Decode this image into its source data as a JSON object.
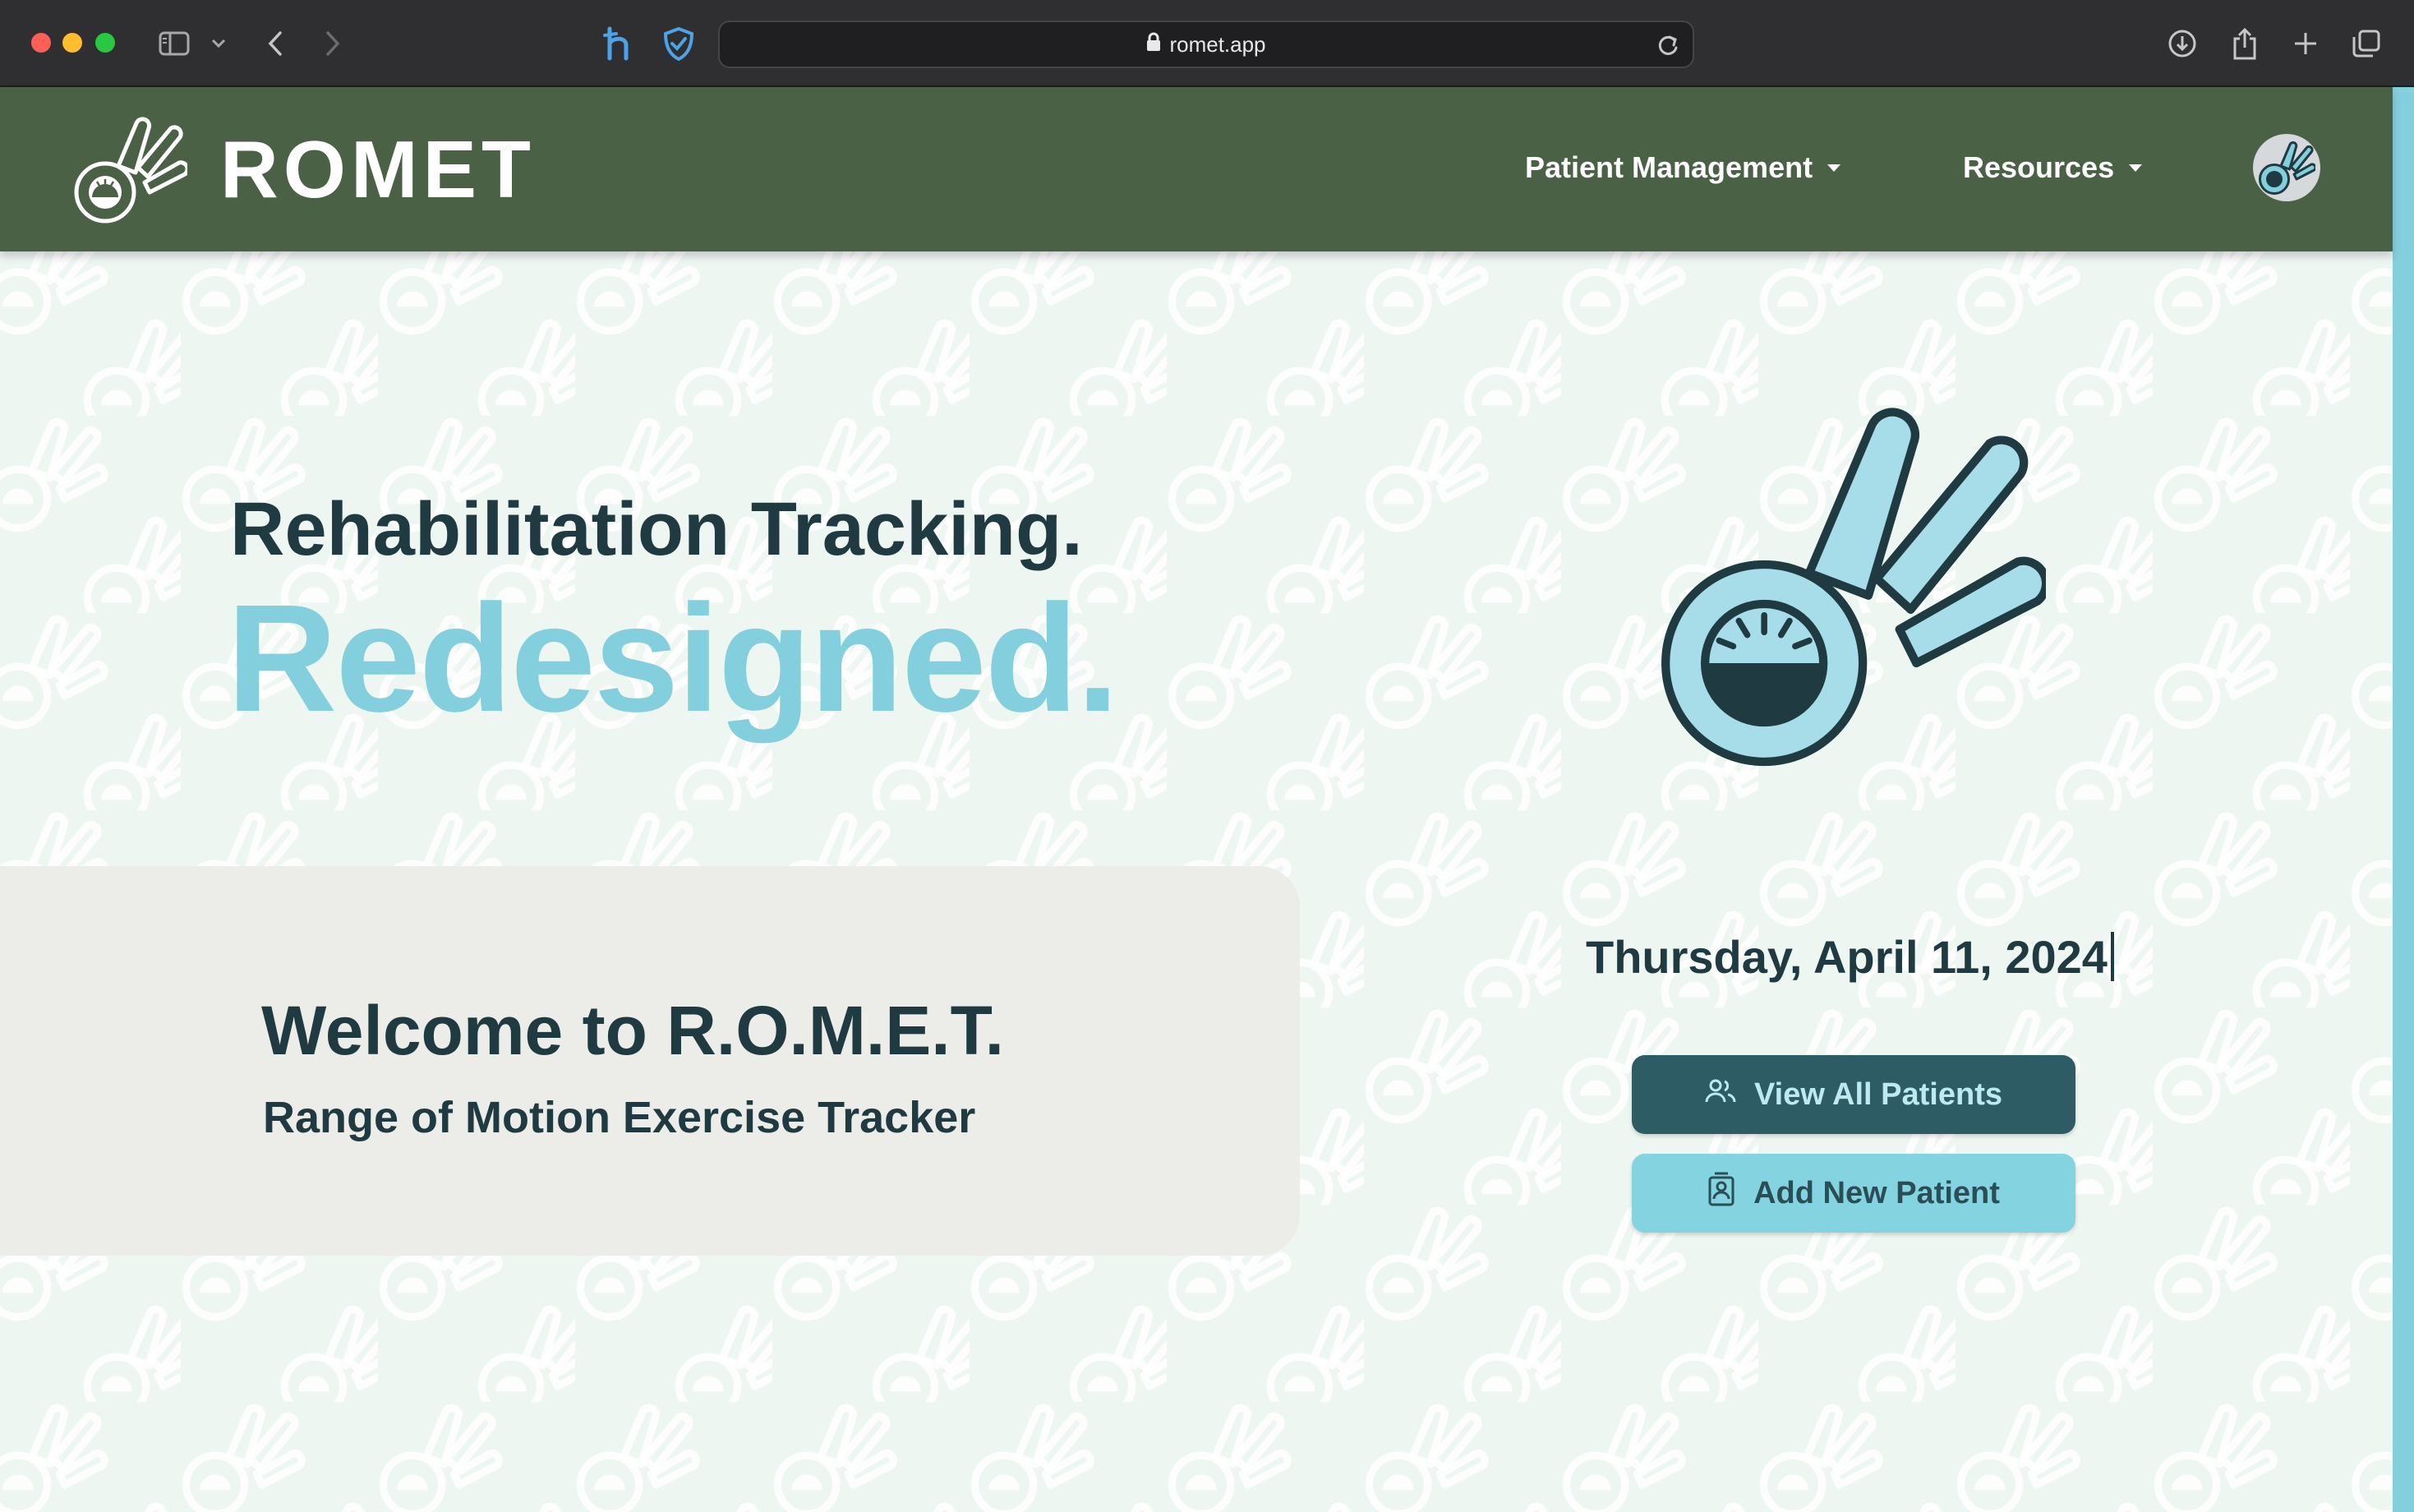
{
  "browser": {
    "url": "romet.app",
    "icons": [
      "sidebar-toggle-icon",
      "chevron-down-icon",
      "back-icon",
      "forward-icon",
      "honey-extension-icon",
      "shield-extension-icon",
      "lock-icon",
      "reload-icon",
      "download-icon",
      "share-icon",
      "new-tab-icon",
      "tab-overview-icon"
    ]
  },
  "navbar": {
    "brand": "ROMET",
    "items": [
      {
        "label": "Patient Management"
      },
      {
        "label": "Resources"
      }
    ],
    "colors": {
      "background": "#4a6146",
      "text": "#ffffff"
    }
  },
  "hero": {
    "line1": "Rehabilitation Tracking.",
    "line2": "Redesigned."
  },
  "welcome": {
    "title": "Welcome to R.O.M.E.T.",
    "subtitle": "Range of Motion Exercise Tracker"
  },
  "date": "Thursday, April 11, 2024",
  "actions": {
    "view_all": {
      "label": "View All Patients",
      "icon": "users-icon"
    },
    "add_new": {
      "label": "Add New Patient",
      "icon": "contact-card-icon"
    }
  },
  "colors": {
    "accent": "#84cfdd",
    "dark": "#1f3a40",
    "primary_button": "#2d5c65",
    "page_background": "#eef6f2"
  }
}
